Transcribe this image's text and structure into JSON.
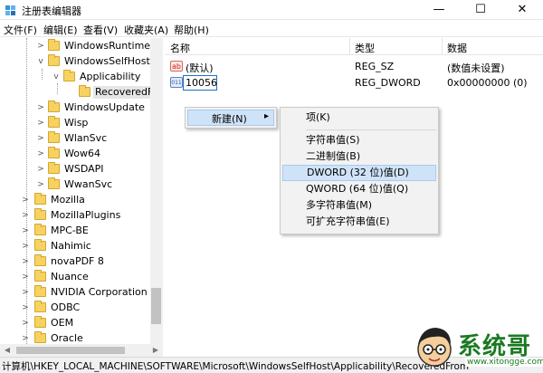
{
  "window": {
    "title": "注册表编辑器",
    "minimize_glyph": "—",
    "maximize_glyph": "☐",
    "close_glyph": "✕"
  },
  "menu": [
    "文件(F)",
    "编辑(E)",
    "查看(V)",
    "收藏夹(A)",
    "帮助(H)"
  ],
  "tree": {
    "items": [
      {
        "label": "WindowsRuntime",
        "expanded": false
      },
      {
        "label": "WindowsSelfHost",
        "expanded": true
      },
      {
        "label": "Applicability",
        "expanded": true
      },
      {
        "label": "RecoveredFr",
        "selected": true
      },
      {
        "label": "WindowsUpdate",
        "expanded": false
      },
      {
        "label": "Wisp",
        "expanded": false
      },
      {
        "label": "WlanSvc",
        "expanded": false
      },
      {
        "label": "Wow64",
        "expanded": false
      },
      {
        "label": "WSDAPI",
        "expanded": false
      },
      {
        "label": "WwanSvc",
        "expanded": false
      },
      {
        "label": "Mozilla",
        "expanded": false
      },
      {
        "label": "MozillaPlugins",
        "expanded": false
      },
      {
        "label": "MPC-BE",
        "expanded": false
      },
      {
        "label": "Nahimic",
        "expanded": false
      },
      {
        "label": "novaPDF 8",
        "expanded": false
      },
      {
        "label": "Nuance",
        "expanded": false
      },
      {
        "label": "NVIDIA Corporation",
        "expanded": false
      },
      {
        "label": "ODBC",
        "expanded": false
      },
      {
        "label": "OEM",
        "expanded": false
      },
      {
        "label": "Oracle",
        "expanded": false
      }
    ]
  },
  "list": {
    "columns": [
      "名称",
      "类型",
      "数据"
    ],
    "rows": [
      {
        "icon": "string-value-icon",
        "icon_glyph": "ab",
        "name": "(默认)",
        "type": "REG_SZ",
        "data": "(数值未设置)"
      },
      {
        "icon": "binary-value-icon",
        "icon_glyph": "011",
        "name": "10056",
        "type": "REG_DWORD",
        "data": "0x00000000 (0)",
        "editing": true
      }
    ]
  },
  "context_menu": {
    "item": "新建(N)",
    "submenu_arrow": "▸"
  },
  "submenu": {
    "key": "项(K)",
    "values": [
      "字符串值(S)",
      "二进制值(B)",
      "DWORD (32 位)值(D)",
      "QWORD (64 位)值(Q)",
      "多字符串值(M)",
      "可扩充字符串值(E)"
    ],
    "highlighted_index": 2
  },
  "statusbar": {
    "path": "计算机\\HKEY_LOCAL_MACHINE\\SOFTWARE\\Microsoft\\WindowsSelfHost\\Applicability\\RecoveredFrom"
  },
  "watermark": {
    "name": "系统哥",
    "url": "www.xitongge.com"
  },
  "colors": {
    "highlight": "#cfe3f8",
    "folder": "#f6d262",
    "watermark": "#1b7a22"
  }
}
